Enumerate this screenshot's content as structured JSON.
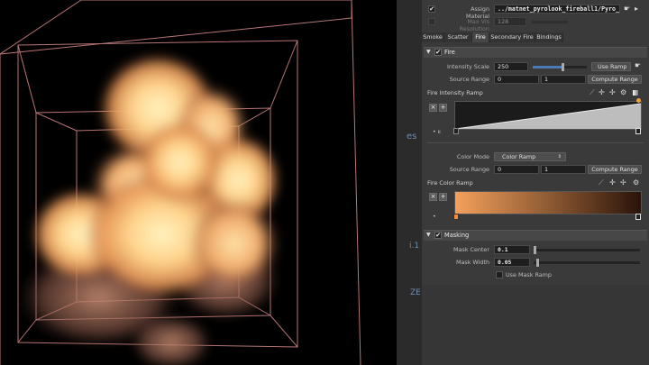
{
  "viewport": {
    "side_glyphs": [
      "es",
      "i.1",
      "ZE"
    ]
  },
  "panel": {
    "top": {
      "assign_material_label": "Assign Material",
      "assign_material_value": "../matnet_pyrolook_fireball1/Pyro_",
      "max_vis_label": "Max Vis Resolution",
      "max_vis_value": "128"
    },
    "tabs": [
      {
        "label": "Smoke"
      },
      {
        "label": "Scatter"
      },
      {
        "label": "Fire"
      },
      {
        "label": "Secondary Fire"
      },
      {
        "label": "Bindings"
      }
    ],
    "fire": {
      "section_title": "Fire",
      "intensity_scale_label": "Intensity Scale",
      "intensity_scale_value": "250",
      "use_ramp_label": "Use Ramp",
      "source_range_label": "Source Range",
      "source_range_min": "0",
      "source_range_max": "1",
      "compute_range_label": "Compute Range",
      "intensity_ramp_label": "Fire Intensity Ramp",
      "color_mode_label": "Color Mode",
      "color_mode_value": "Color Ramp",
      "source_range2_label": "Source Range",
      "source_range2_min": "0",
      "source_range2_max": "1",
      "compute_range2_label": "Compute Range",
      "color_ramp_label": "Fire Color Ramp",
      "intensity_slider_fraction": 0.55
    },
    "masking": {
      "section_title": "Masking",
      "mask_center_label": "Mask Center",
      "mask_center_value": "0.1",
      "mask_width_label": "Mask Width",
      "mask_width_value": "0.05",
      "use_mask_ramp_label": "Use Mask Ramp"
    }
  },
  "colors": {
    "panel_bg": "#3a3a3a",
    "field_bg": "#1e1e1e",
    "accent": "#4e79b8",
    "ramp_start": "#f4a15c",
    "ramp_end": "#2a140a",
    "box_lines": "#d88a8a"
  },
  "icons": [
    "check-icon",
    "hand-icon",
    "play-icon",
    "collapse-triangle-icon",
    "eyedropper-icon",
    "crosshair-icon",
    "gear-icon",
    "chevron-down-icon"
  ]
}
